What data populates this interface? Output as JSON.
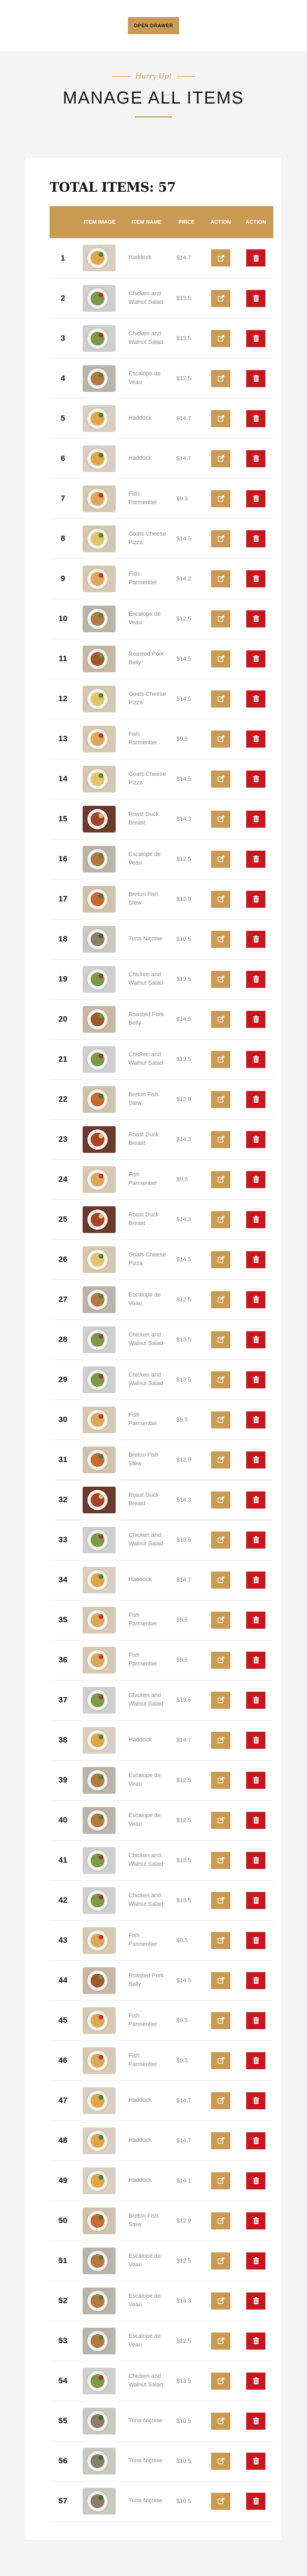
{
  "header": {
    "open_drawer_label": "OPEN DRAWER"
  },
  "hero": {
    "subtitle": "Hurry Up!",
    "title": "MANAGE ALL ITEMS"
  },
  "summary": {
    "total_label": "TOTAL ITEMS: 57"
  },
  "table": {
    "columns": [
      "#",
      "ITEM IMAGE",
      "ITEM NAME",
      "PRICE",
      "ACTION",
      "ACTION"
    ],
    "rows": [
      {
        "num": "1",
        "name": "Haddock",
        "price": "$14.7",
        "dish": "haddock"
      },
      {
        "num": "2",
        "name": "Chicken and Walnut Salad",
        "price": "$13.5",
        "dish": "salad"
      },
      {
        "num": "3",
        "name": "Chicken and Walnut Salad",
        "price": "$13.5",
        "dish": "salad"
      },
      {
        "num": "4",
        "name": "Escalope de Veau",
        "price": "$12.5",
        "dish": "veau"
      },
      {
        "num": "5",
        "name": "Haddock",
        "price": "$14.7",
        "dish": "haddock"
      },
      {
        "num": "6",
        "name": "Haddock",
        "price": "$14.7",
        "dish": "haddock"
      },
      {
        "num": "7",
        "name": "Fish Parmentier",
        "price": "$9.5",
        "dish": "fish"
      },
      {
        "num": "8",
        "name": "Goats Cheese Pizza",
        "price": "$14.5",
        "dish": "pizza"
      },
      {
        "num": "9",
        "name": "Fish Parmentier",
        "price": "$14.2",
        "dish": "fish"
      },
      {
        "num": "10",
        "name": "Escalope de Veau",
        "price": "$12.5",
        "dish": "veau"
      },
      {
        "num": "11",
        "name": "Roasted Pork Belly",
        "price": "$14.5",
        "dish": "pork"
      },
      {
        "num": "12",
        "name": "Goats Cheese Pizza",
        "price": "$14.5",
        "dish": "pizza"
      },
      {
        "num": "13",
        "name": "Fish Parmentier",
        "price": "$9.5",
        "dish": "fish"
      },
      {
        "num": "14",
        "name": "Goats Cheese Pizza",
        "price": "$14.5",
        "dish": "pizza"
      },
      {
        "num": "15",
        "name": "Roast Duck Breast",
        "price": "$14.3",
        "dish": "duck"
      },
      {
        "num": "16",
        "name": "Escalope de Veau",
        "price": "$12.5",
        "dish": "veau"
      },
      {
        "num": "17",
        "name": "Breton Fish Stew",
        "price": "$12.9",
        "dish": "stew"
      },
      {
        "num": "18",
        "name": "Tuna Niçoise",
        "price": "$10.5",
        "dish": "tuna"
      },
      {
        "num": "19",
        "name": "Chicken and Walnut Salad",
        "price": "$13.5",
        "dish": "salad"
      },
      {
        "num": "20",
        "name": "Roasted Pork Belly",
        "price": "$14.5",
        "dish": "pork"
      },
      {
        "num": "21",
        "name": "Chicken and Walnut Salad",
        "price": "$13.5",
        "dish": "salad"
      },
      {
        "num": "22",
        "name": "Breton Fish Stew",
        "price": "$12.9",
        "dish": "stew"
      },
      {
        "num": "23",
        "name": "Roast Duck Breast",
        "price": "$14.3",
        "dish": "duck"
      },
      {
        "num": "24",
        "name": "Fish Parmentier",
        "price": "$9.5",
        "dish": "fish"
      },
      {
        "num": "25",
        "name": "Roast Duck Breast",
        "price": "$14.3",
        "dish": "duck"
      },
      {
        "num": "26",
        "name": "Goats Cheese Pizza",
        "price": "$14.5",
        "dish": "pizza"
      },
      {
        "num": "27",
        "name": "Escalope de Veau",
        "price": "$12.5",
        "dish": "veau"
      },
      {
        "num": "28",
        "name": "Chicken and Walnut Salad",
        "price": "$13.5",
        "dish": "salad"
      },
      {
        "num": "29",
        "name": "Chicken and Walnut Salad",
        "price": "$13.5",
        "dish": "salad"
      },
      {
        "num": "30",
        "name": "Fish Parmentier",
        "price": "$9.5",
        "dish": "fish"
      },
      {
        "num": "31",
        "name": "Breton Fish Stew",
        "price": "$12.9",
        "dish": "stew"
      },
      {
        "num": "32",
        "name": "Roast Duck Breast",
        "price": "$14.3",
        "dish": "duck"
      },
      {
        "num": "33",
        "name": "Chicken and Walnut Salad",
        "price": "$13.5",
        "dish": "salad"
      },
      {
        "num": "34",
        "name": "Haddock",
        "price": "$14.7",
        "dish": "haddock"
      },
      {
        "num": "35",
        "name": "Fish Parmentier",
        "price": "$9.5",
        "dish": "fish"
      },
      {
        "num": "36",
        "name": "Fish Parmentier",
        "price": "$9.5",
        "dish": "fish"
      },
      {
        "num": "37",
        "name": "Chicken and Walnut Salad",
        "price": "$13.5",
        "dish": "salad"
      },
      {
        "num": "38",
        "name": "Haddock",
        "price": "$14.7",
        "dish": "haddock"
      },
      {
        "num": "39",
        "name": "Escalope de Veau",
        "price": "$12.5",
        "dish": "veau"
      },
      {
        "num": "40",
        "name": "Escalope de Veau",
        "price": "$12.5",
        "dish": "veau"
      },
      {
        "num": "41",
        "name": "Chicken and Walnut Salad",
        "price": "$13.5",
        "dish": "salad"
      },
      {
        "num": "42",
        "name": "Chicken and Walnut Salad",
        "price": "$13.5",
        "dish": "salad"
      },
      {
        "num": "43",
        "name": "Fish Parmentier",
        "price": "$9.5",
        "dish": "fish"
      },
      {
        "num": "44",
        "name": "Roasted Pork Belly",
        "price": "$14.5",
        "dish": "pork"
      },
      {
        "num": "45",
        "name": "Fish Parmentier",
        "price": "$9.5",
        "dish": "fish"
      },
      {
        "num": "46",
        "name": "Fish Parmentier",
        "price": "$9.5",
        "dish": "fish"
      },
      {
        "num": "47",
        "name": "Haddock",
        "price": "$14.7",
        "dish": "haddock"
      },
      {
        "num": "48",
        "name": "Haddock",
        "price": "$14.7",
        "dish": "haddock"
      },
      {
        "num": "49",
        "name": "Haddock",
        "price": "$14.1",
        "dish": "haddock"
      },
      {
        "num": "50",
        "name": "Breton Fish Stew",
        "price": "$12.9",
        "dish": "stew"
      },
      {
        "num": "51",
        "name": "Escalope de Veau",
        "price": "$12.5",
        "dish": "veau"
      },
      {
        "num": "52",
        "name": "Escalope de Veau",
        "price": "$14.3",
        "dish": "veau"
      },
      {
        "num": "53",
        "name": "Escalope de Veau",
        "price": "$12.5",
        "dish": "veau"
      },
      {
        "num": "54",
        "name": "Chicken and Walnut Salad",
        "price": "$13.5",
        "dish": "salad"
      },
      {
        "num": "55",
        "name": "Tuna Niçoise",
        "price": "$10.5",
        "dish": "tuna"
      },
      {
        "num": "56",
        "name": "Tuna Niçoise",
        "price": "$10.5",
        "dish": "tuna"
      },
      {
        "num": "57",
        "name": "Tuna Niçoise",
        "price": "$10.5",
        "dish": "tuna"
      }
    ]
  },
  "icons": {
    "edit": "edit-icon",
    "delete": "trash-icon"
  },
  "colors": {
    "accent": "#c99a53",
    "danger": "#c8161d",
    "page_bg": "#f4f4f4"
  }
}
